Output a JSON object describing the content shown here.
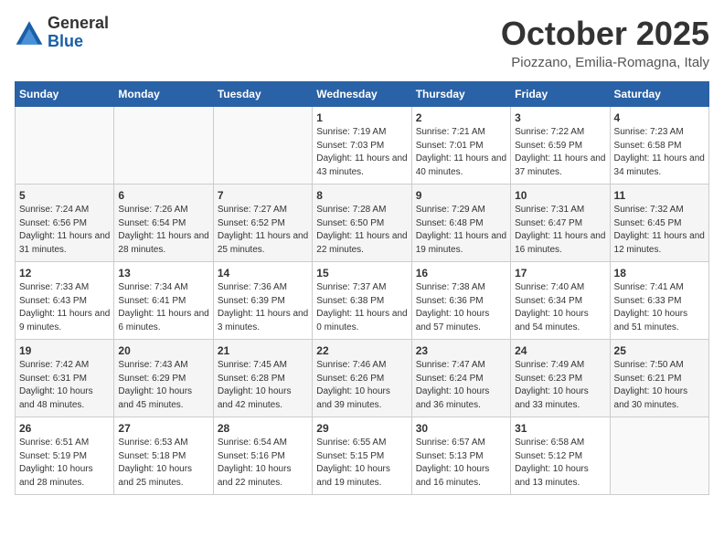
{
  "logo": {
    "general": "General",
    "blue": "Blue"
  },
  "title": "October 2025",
  "location": "Piozzano, Emilia-Romagna, Italy",
  "weekdays": [
    "Sunday",
    "Monday",
    "Tuesday",
    "Wednesday",
    "Thursday",
    "Friday",
    "Saturday"
  ],
  "weeks": [
    [
      {
        "day": "",
        "sunrise": "",
        "sunset": "",
        "daylight": ""
      },
      {
        "day": "",
        "sunrise": "",
        "sunset": "",
        "daylight": ""
      },
      {
        "day": "",
        "sunrise": "",
        "sunset": "",
        "daylight": ""
      },
      {
        "day": "1",
        "sunrise": "Sunrise: 7:19 AM",
        "sunset": "Sunset: 7:03 PM",
        "daylight": "Daylight: 11 hours and 43 minutes."
      },
      {
        "day": "2",
        "sunrise": "Sunrise: 7:21 AM",
        "sunset": "Sunset: 7:01 PM",
        "daylight": "Daylight: 11 hours and 40 minutes."
      },
      {
        "day": "3",
        "sunrise": "Sunrise: 7:22 AM",
        "sunset": "Sunset: 6:59 PM",
        "daylight": "Daylight: 11 hours and 37 minutes."
      },
      {
        "day": "4",
        "sunrise": "Sunrise: 7:23 AM",
        "sunset": "Sunset: 6:58 PM",
        "daylight": "Daylight: 11 hours and 34 minutes."
      }
    ],
    [
      {
        "day": "5",
        "sunrise": "Sunrise: 7:24 AM",
        "sunset": "Sunset: 6:56 PM",
        "daylight": "Daylight: 11 hours and 31 minutes."
      },
      {
        "day": "6",
        "sunrise": "Sunrise: 7:26 AM",
        "sunset": "Sunset: 6:54 PM",
        "daylight": "Daylight: 11 hours and 28 minutes."
      },
      {
        "day": "7",
        "sunrise": "Sunrise: 7:27 AM",
        "sunset": "Sunset: 6:52 PM",
        "daylight": "Daylight: 11 hours and 25 minutes."
      },
      {
        "day": "8",
        "sunrise": "Sunrise: 7:28 AM",
        "sunset": "Sunset: 6:50 PM",
        "daylight": "Daylight: 11 hours and 22 minutes."
      },
      {
        "day": "9",
        "sunrise": "Sunrise: 7:29 AM",
        "sunset": "Sunset: 6:48 PM",
        "daylight": "Daylight: 11 hours and 19 minutes."
      },
      {
        "day": "10",
        "sunrise": "Sunrise: 7:31 AM",
        "sunset": "Sunset: 6:47 PM",
        "daylight": "Daylight: 11 hours and 16 minutes."
      },
      {
        "day": "11",
        "sunrise": "Sunrise: 7:32 AM",
        "sunset": "Sunset: 6:45 PM",
        "daylight": "Daylight: 11 hours and 12 minutes."
      }
    ],
    [
      {
        "day": "12",
        "sunrise": "Sunrise: 7:33 AM",
        "sunset": "Sunset: 6:43 PM",
        "daylight": "Daylight: 11 hours and 9 minutes."
      },
      {
        "day": "13",
        "sunrise": "Sunrise: 7:34 AM",
        "sunset": "Sunset: 6:41 PM",
        "daylight": "Daylight: 11 hours and 6 minutes."
      },
      {
        "day": "14",
        "sunrise": "Sunrise: 7:36 AM",
        "sunset": "Sunset: 6:39 PM",
        "daylight": "Daylight: 11 hours and 3 minutes."
      },
      {
        "day": "15",
        "sunrise": "Sunrise: 7:37 AM",
        "sunset": "Sunset: 6:38 PM",
        "daylight": "Daylight: 11 hours and 0 minutes."
      },
      {
        "day": "16",
        "sunrise": "Sunrise: 7:38 AM",
        "sunset": "Sunset: 6:36 PM",
        "daylight": "Daylight: 10 hours and 57 minutes."
      },
      {
        "day": "17",
        "sunrise": "Sunrise: 7:40 AM",
        "sunset": "Sunset: 6:34 PM",
        "daylight": "Daylight: 10 hours and 54 minutes."
      },
      {
        "day": "18",
        "sunrise": "Sunrise: 7:41 AM",
        "sunset": "Sunset: 6:33 PM",
        "daylight": "Daylight: 10 hours and 51 minutes."
      }
    ],
    [
      {
        "day": "19",
        "sunrise": "Sunrise: 7:42 AM",
        "sunset": "Sunset: 6:31 PM",
        "daylight": "Daylight: 10 hours and 48 minutes."
      },
      {
        "day": "20",
        "sunrise": "Sunrise: 7:43 AM",
        "sunset": "Sunset: 6:29 PM",
        "daylight": "Daylight: 10 hours and 45 minutes."
      },
      {
        "day": "21",
        "sunrise": "Sunrise: 7:45 AM",
        "sunset": "Sunset: 6:28 PM",
        "daylight": "Daylight: 10 hours and 42 minutes."
      },
      {
        "day": "22",
        "sunrise": "Sunrise: 7:46 AM",
        "sunset": "Sunset: 6:26 PM",
        "daylight": "Daylight: 10 hours and 39 minutes."
      },
      {
        "day": "23",
        "sunrise": "Sunrise: 7:47 AM",
        "sunset": "Sunset: 6:24 PM",
        "daylight": "Daylight: 10 hours and 36 minutes."
      },
      {
        "day": "24",
        "sunrise": "Sunrise: 7:49 AM",
        "sunset": "Sunset: 6:23 PM",
        "daylight": "Daylight: 10 hours and 33 minutes."
      },
      {
        "day": "25",
        "sunrise": "Sunrise: 7:50 AM",
        "sunset": "Sunset: 6:21 PM",
        "daylight": "Daylight: 10 hours and 30 minutes."
      }
    ],
    [
      {
        "day": "26",
        "sunrise": "Sunrise: 6:51 AM",
        "sunset": "Sunset: 5:19 PM",
        "daylight": "Daylight: 10 hours and 28 minutes."
      },
      {
        "day": "27",
        "sunrise": "Sunrise: 6:53 AM",
        "sunset": "Sunset: 5:18 PM",
        "daylight": "Daylight: 10 hours and 25 minutes."
      },
      {
        "day": "28",
        "sunrise": "Sunrise: 6:54 AM",
        "sunset": "Sunset: 5:16 PM",
        "daylight": "Daylight: 10 hours and 22 minutes."
      },
      {
        "day": "29",
        "sunrise": "Sunrise: 6:55 AM",
        "sunset": "Sunset: 5:15 PM",
        "daylight": "Daylight: 10 hours and 19 minutes."
      },
      {
        "day": "30",
        "sunrise": "Sunrise: 6:57 AM",
        "sunset": "Sunset: 5:13 PM",
        "daylight": "Daylight: 10 hours and 16 minutes."
      },
      {
        "day": "31",
        "sunrise": "Sunrise: 6:58 AM",
        "sunset": "Sunset: 5:12 PM",
        "daylight": "Daylight: 10 hours and 13 minutes."
      },
      {
        "day": "",
        "sunrise": "",
        "sunset": "",
        "daylight": ""
      }
    ]
  ]
}
